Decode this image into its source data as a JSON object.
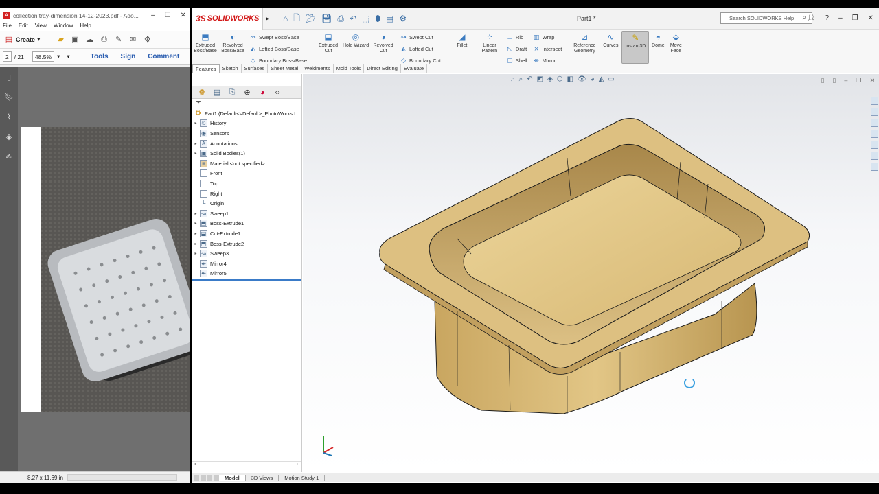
{
  "acrobat": {
    "window_title": "collection tray-dimension 14-12-2023.pdf - Ado...",
    "menu": [
      "File",
      "Edit",
      "View",
      "Window",
      "Help"
    ],
    "create_label": "Create",
    "page_current": "2",
    "page_total": "/ 21",
    "zoom": "48.5%",
    "tools_label": "Tools",
    "sign_label": "Sign",
    "comment_label": "Comment",
    "page_size": "8.27 x 11.69 in"
  },
  "solidworks": {
    "logo_ds": "3S",
    "logo_text": "SOLIDWORKS",
    "doc_title": "Part1 *",
    "search_placeholder": "Search SOLIDWORKS Help",
    "ribbon": {
      "extruded_boss": "Extruded Boss/Base",
      "revolved_boss": "Revolved Boss/Base",
      "swept_boss": "Swept Boss/Base",
      "lofted_boss": "Lofted Boss/Base",
      "boundary_boss": "Boundary Boss/Base",
      "extruded_cut": "Extruded Cut",
      "hole_wizard": "Hole Wizard",
      "revolved_cut": "Revolved Cut",
      "swept_cut": "Swept Cut",
      "lofted_cut": "Lofted Cut",
      "boundary_cut": "Boundary Cut",
      "fillet": "Fillet",
      "linear_pattern": "Linear Pattern",
      "rib": "Rib",
      "draft": "Draft",
      "shell": "Shell",
      "wrap": "Wrap",
      "intersect": "Intersect",
      "mirror": "Mirror",
      "reference_geometry": "Reference Geometry",
      "curves": "Curves",
      "instant3d": "Instant3D",
      "dome": "Dome",
      "move_face": "Move Face"
    },
    "command_tabs": [
      "Features",
      "Sketch",
      "Surfaces",
      "Sheet Metal",
      "Weldments",
      "Mold Tools",
      "Direct Editing",
      "Evaluate"
    ],
    "tree": {
      "root": "Part1  (Default<<Default>_PhotoWorks I",
      "items": [
        {
          "label": "History",
          "expand": "▸"
        },
        {
          "label": "Sensors",
          "expand": ""
        },
        {
          "label": "Annotations",
          "expand": "▸"
        },
        {
          "label": "Solid Bodies(1)",
          "expand": "▸"
        },
        {
          "label": "Material <not specified>",
          "expand": ""
        },
        {
          "label": "Front",
          "expand": ""
        },
        {
          "label": "Top",
          "expand": ""
        },
        {
          "label": "Right",
          "expand": ""
        },
        {
          "label": "Origin",
          "expand": ""
        },
        {
          "label": "Sweep1",
          "expand": "▸"
        },
        {
          "label": "Boss-Extrude1",
          "expand": "▸"
        },
        {
          "label": "Cut-Extrude1",
          "expand": "▸"
        },
        {
          "label": "Boss-Extrude2",
          "expand": "▸"
        },
        {
          "label": "Sweep3",
          "expand": "▸"
        },
        {
          "label": "Mirror4",
          "expand": ""
        },
        {
          "label": "Mirror5",
          "expand": ""
        }
      ]
    },
    "bottom_tabs": [
      "Model",
      "3D Views",
      "Motion Study 1"
    ],
    "colors": {
      "part": "#d9b870",
      "part_edge": "#1a1a1a",
      "accent": "#3a7bc8"
    }
  }
}
